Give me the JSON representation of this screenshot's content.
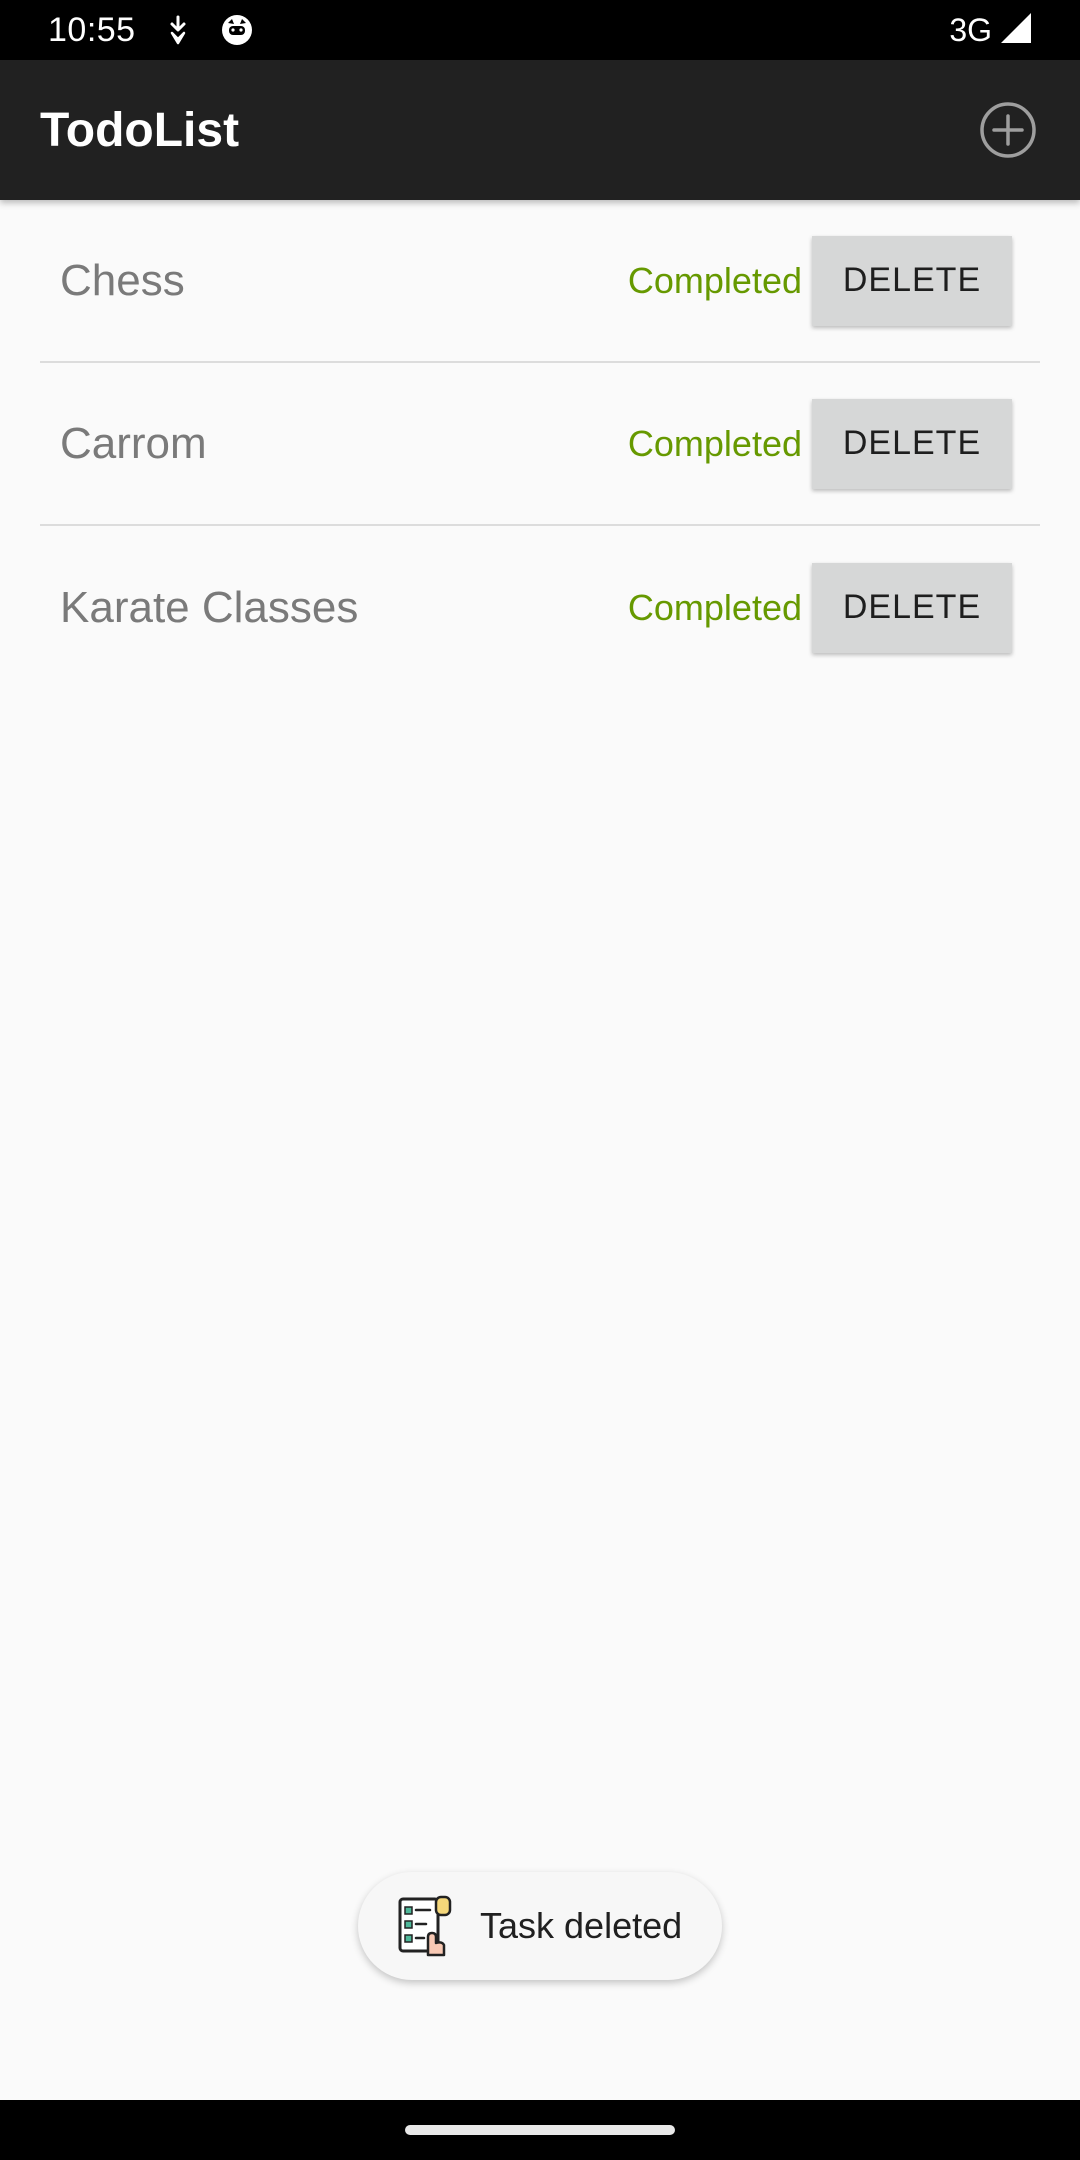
{
  "status_bar": {
    "time": "10:55",
    "network": "3G",
    "icons": [
      "download-notification-icon",
      "cat-face-notification-icon",
      "signal-icon"
    ]
  },
  "app_bar": {
    "title": "TodoList",
    "add_icon": "add-circle-icon"
  },
  "tasks": [
    {
      "name": "Chess",
      "status": "Completed",
      "delete_label": "DELETE"
    },
    {
      "name": "Carrom",
      "status": "Completed",
      "delete_label": "DELETE"
    },
    {
      "name": "Karate Classes",
      "status": "Completed",
      "delete_label": "DELETE"
    }
  ],
  "toast": {
    "message": "Task deleted",
    "icon": "checklist-app-icon"
  },
  "colors": {
    "app_bar": "#212121",
    "status_completed": "#669900",
    "delete_button": "#d6d7d7",
    "background": "#fafafa"
  }
}
